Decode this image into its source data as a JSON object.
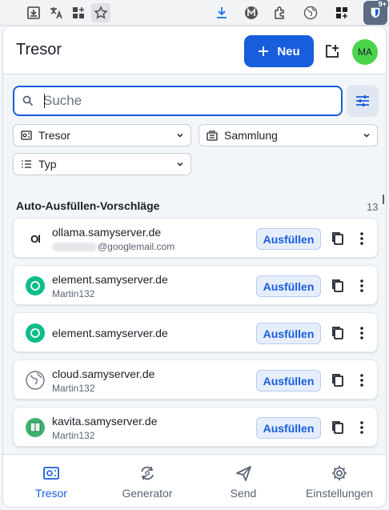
{
  "browser": {
    "badge_count": "9+",
    "icons": [
      "save-page-icon",
      "translate-icon",
      "extensions-grid-icon",
      "bookmark-star-icon",
      "download-icon",
      "m-extension-icon",
      "puzzle-icon",
      "globe-extension-icon",
      "apps-grid-icon",
      "bitwarden-shield-icon"
    ]
  },
  "header": {
    "title": "Tresor",
    "new_label": "Neu",
    "avatar_initials": "MA"
  },
  "search": {
    "placeholder": "Suche",
    "value": ""
  },
  "filters": {
    "vault": "Tresor",
    "collection": "Sammlung",
    "type": "Typ"
  },
  "section": {
    "title": "Auto-Ausfüllen-Vorschläge",
    "count": "13"
  },
  "items": [
    {
      "name": "ollama.samyserver.de",
      "username": "@googlemail.com",
      "icon": "ollama-icon",
      "fill_label": "Ausfüllen"
    },
    {
      "name": "element.samyserver.de",
      "username": "Martin132",
      "icon": "element-icon",
      "fill_label": "Ausfüllen"
    },
    {
      "name": "element.samyserver.de",
      "username": "",
      "icon": "element-icon",
      "fill_label": "Ausfüllen"
    },
    {
      "name": "cloud.samyserver.de",
      "username": "Martin132",
      "icon": "globe-icon",
      "fill_label": "Ausfüllen"
    },
    {
      "name": "kavita.samyserver.de",
      "username": "Martin132",
      "icon": "kavita-icon",
      "fill_label": "Ausfüllen"
    }
  ],
  "nav": {
    "vault": "Tresor",
    "generator": "Generator",
    "send": "Send",
    "settings": "Einstellungen"
  },
  "colors": {
    "accent": "#175ddc",
    "avatar": "#4bd34b",
    "element": "#0dbd8b"
  }
}
